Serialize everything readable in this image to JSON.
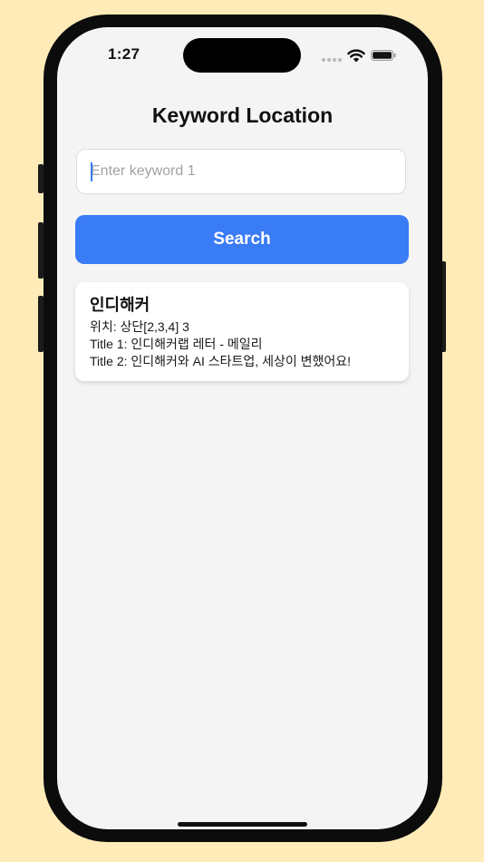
{
  "status_bar": {
    "time": "1:27"
  },
  "header": {
    "title": "Keyword Location"
  },
  "search": {
    "placeholder": "Enter keyword 1",
    "value": "",
    "button_label": "Search"
  },
  "results": [
    {
      "keyword": "인디해커",
      "location": "위치: 상단[2,3,4] 3",
      "title1": "Title 1: 인디해커랩 레터 - 메일리",
      "title2": "Title 2: 인디해커와 AI 스타트업, 세상이 변했어요!"
    }
  ],
  "colors": {
    "background": "#ffebb8",
    "screen": "#f4f4f4",
    "accent": "#3a7bf6"
  }
}
